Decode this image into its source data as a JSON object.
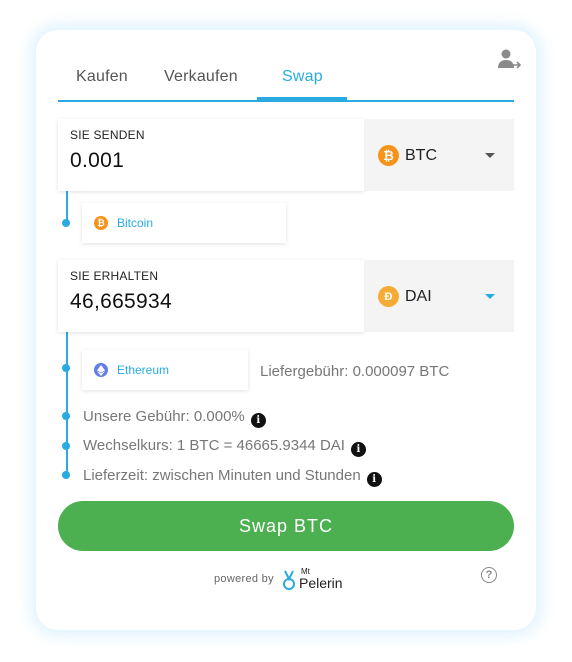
{
  "tabs": [
    {
      "label": "Kaufen"
    },
    {
      "label": "Verkaufen"
    },
    {
      "label": "Swap",
      "active": true
    }
  ],
  "send": {
    "label": "SIE SENDEN",
    "amount": "0.001",
    "currency": "BTC",
    "currency_icon": "bitcoin-icon",
    "network": "Bitcoin",
    "network_icon": "bitcoin-icon"
  },
  "receive": {
    "label": "SIE ERHALTEN",
    "amount": "46,665934",
    "currency": "DAI",
    "currency_icon": "dai-icon",
    "network": "Ethereum",
    "network_icon": "ethereum-icon"
  },
  "delivery_fee": "Liefergebühr: 0.000097 BTC",
  "details": {
    "fee": "Unsere Gebühr: 0.000%",
    "rate": "Wechselkurs: 1 BTC = 46665.9344 DAI",
    "delivery_time": "Lieferzeit: zwischen Minuten und Stunden"
  },
  "swap_button": "Swap BTC",
  "footer": {
    "powered_by": "powered by",
    "brand_prefix": "Mt",
    "brand_name": "Pelerin"
  },
  "colors": {
    "accent": "#29abe2",
    "button": "#4caf50",
    "bitcoin": "#f7931a",
    "dai": "#f5ac37",
    "ethereum": "#627eea"
  }
}
